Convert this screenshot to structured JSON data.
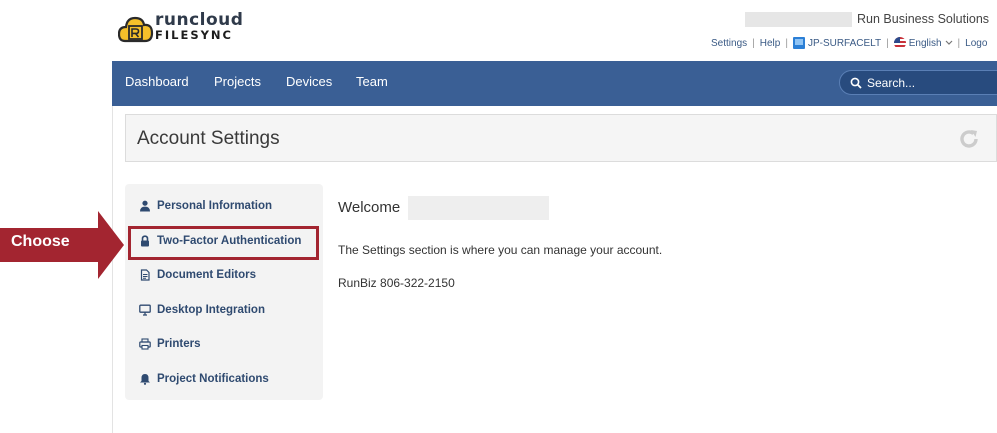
{
  "logo": {
    "top_text": "runcloud",
    "bottom_text": "FILESYNC",
    "colors": {
      "cloud": "#f5c02a",
      "outline": "#2a2a2a"
    }
  },
  "header": {
    "company": "Run Business Solutions",
    "links": {
      "settings": "Settings",
      "help": "Help",
      "device": "JP-SURFACELT",
      "language": "English",
      "logout": "Logo"
    },
    "separator": "|"
  },
  "nav": {
    "items": [
      "Dashboard",
      "Projects",
      "Devices",
      "Team"
    ],
    "search_label": "Search...",
    "bg_color": "#3a5f95"
  },
  "page": {
    "title": "Account Settings"
  },
  "sidebar": {
    "items": [
      {
        "label": "Personal Information",
        "icon": "user-icon"
      },
      {
        "label": "Two-Factor Authentication",
        "icon": "lock-icon"
      },
      {
        "label": "Document Editors",
        "icon": "document-icon"
      },
      {
        "label": "Desktop Integration",
        "icon": "monitor-icon"
      },
      {
        "label": "Printers",
        "icon": "printer-icon"
      },
      {
        "label": "Project Notifications",
        "icon": "bell-icon"
      }
    ],
    "selected_index": 1
  },
  "callout": {
    "label": "Choose",
    "color": "#a32530"
  },
  "main": {
    "welcome": "Welcome",
    "description": "The Settings section is where you can manage your account.",
    "phone": "RunBiz 806-322-2150"
  }
}
